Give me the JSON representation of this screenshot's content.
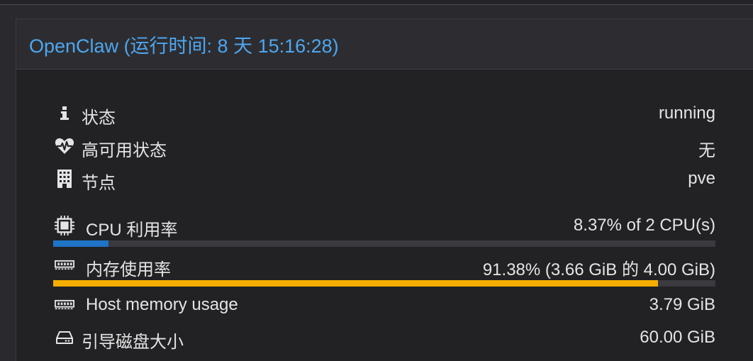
{
  "panel": {
    "title": "OpenClaw (运行时间: 8 天 15:16:28)"
  },
  "status_rows": [
    {
      "label": "状态",
      "value": "running",
      "icon": "info-icon"
    },
    {
      "label": "高可用状态",
      "value": "无",
      "icon": "heartbeat-icon"
    },
    {
      "label": "节点",
      "value": "pve",
      "icon": "building-icon"
    }
  ],
  "cpu": {
    "label": "CPU 利用率",
    "value": "8.37% of 2 CPU(s)",
    "percent": 8.37,
    "icon": "cpu-icon",
    "bar_color": "#1e74c6"
  },
  "memory": {
    "label": "内存使用率",
    "value": "91.38% (3.66 GiB 的 4.00 GiB)",
    "percent": 91.38,
    "icon": "memory-icon",
    "bar_color": "#f5ad00"
  },
  "host_memory": {
    "label": "Host memory usage",
    "value": "3.79 GiB",
    "icon": "memory-icon"
  },
  "boot_disk": {
    "label": "引导磁盘大小",
    "value": "60.00 GiB",
    "icon": "hard-drive-icon"
  },
  "colors": {
    "title": "#4ea6f0",
    "text": "#e4e4e4",
    "bar_track": "#3a3a3f"
  }
}
